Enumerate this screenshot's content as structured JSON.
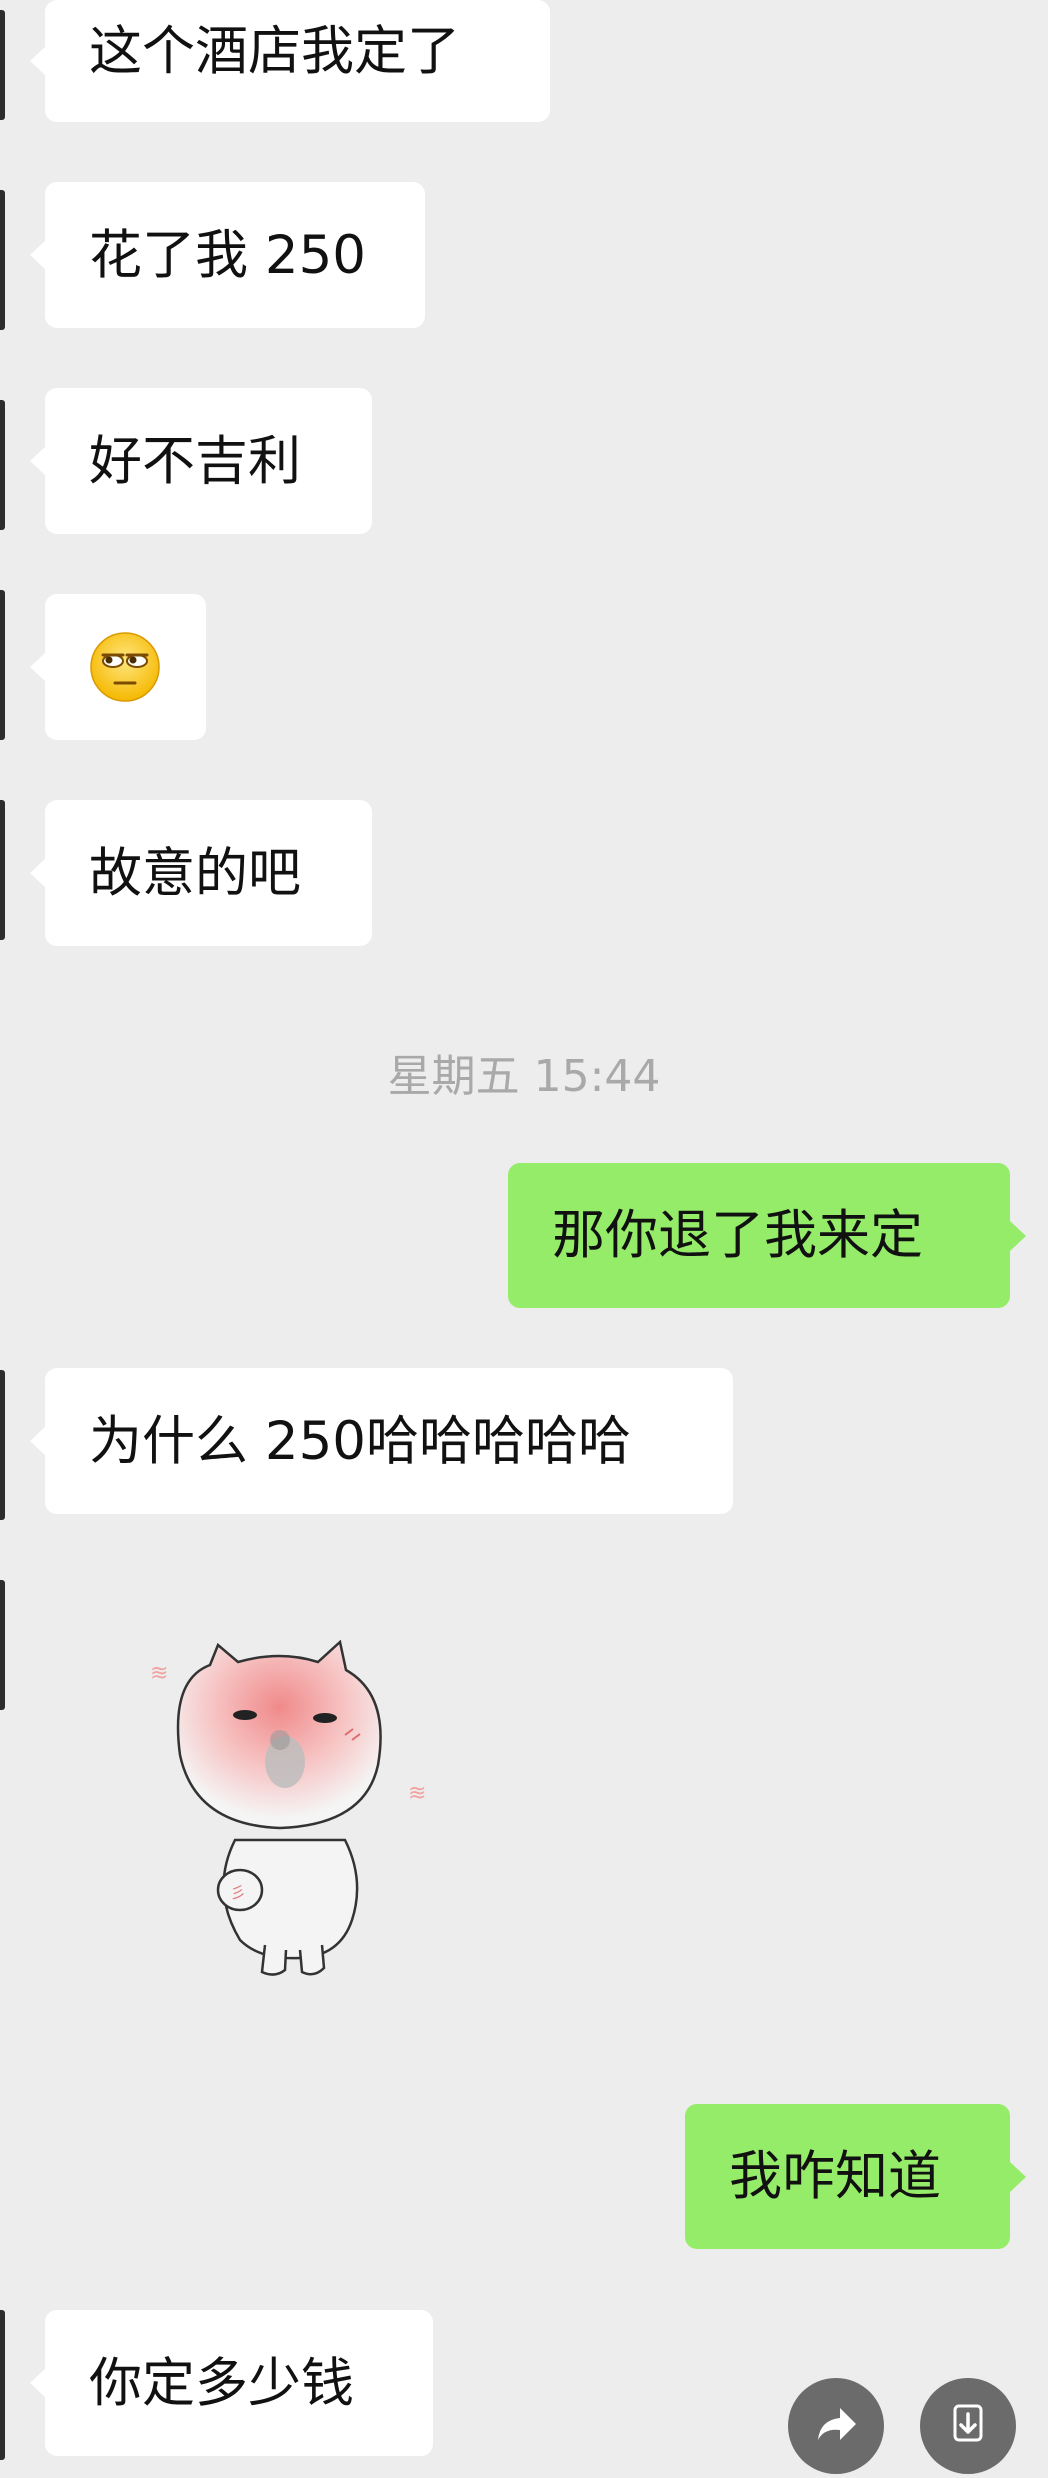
{
  "messages": [
    {
      "side": "in",
      "text": "这个酒店我定了"
    },
    {
      "side": "in",
      "text": "花了我 250"
    },
    {
      "side": "in",
      "text": "好不吉利"
    },
    {
      "side": "in",
      "emoji": "eye-roll-emoji"
    },
    {
      "side": "in",
      "text": "故意的吧"
    },
    {
      "timestamp": "星期五 15:44"
    },
    {
      "side": "out",
      "text": "那你退了我来定"
    },
    {
      "side": "in",
      "text": "为什么 250哈哈哈哈哈"
    },
    {
      "side": "in",
      "sticker": "blushing-cat-sticker"
    },
    {
      "side": "out",
      "text": "我咋知道"
    },
    {
      "side": "in",
      "text": "你定多少钱"
    }
  ],
  "colors": {
    "background": "#ededed",
    "incoming_bubble": "#ffffff",
    "outgoing_bubble": "#95ec69",
    "timestamp_text": "#a9a9a9"
  },
  "floating_actions": [
    {
      "icon": "share-forward-icon"
    },
    {
      "icon": "download-icon"
    }
  ]
}
